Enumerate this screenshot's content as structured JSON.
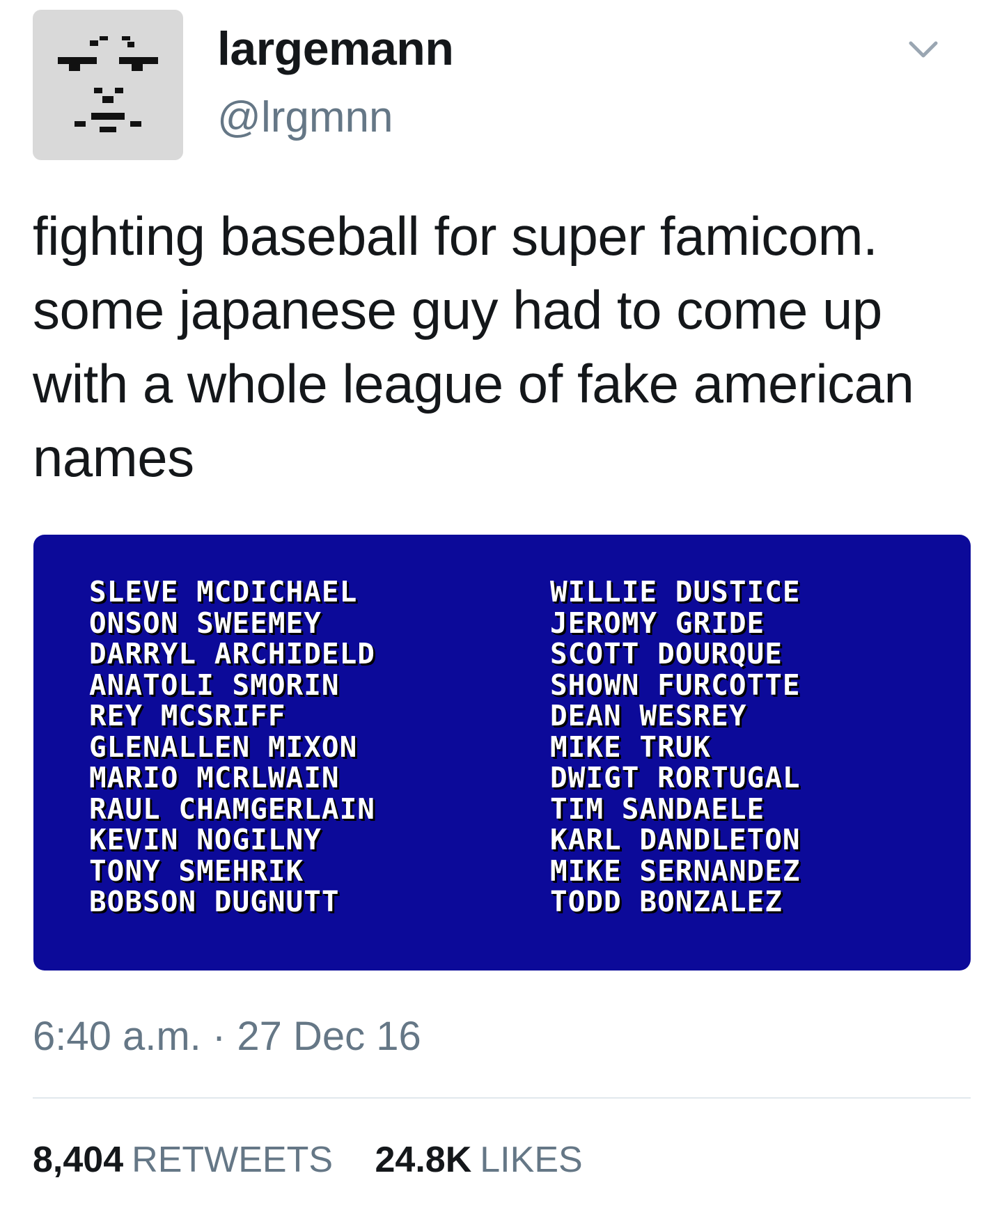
{
  "user": {
    "display_name": "largemann",
    "handle": "@lrgmnn",
    "avatar_icon": "pixel-face-icon"
  },
  "menu": {
    "icon": "chevron-down-icon"
  },
  "tweet": {
    "text": "fighting baseball for super famicom. some japanese guy had to come up with a whole league of fake american names",
    "timestamp": "6:40 a.m. · 27 Dec 16"
  },
  "media": {
    "background_color": "#0c0a99",
    "left_names": [
      "SLEVE MCDICHAEL",
      "ONSON SWEEMEY",
      "DARRYL ARCHIDELD",
      "ANATOLI SMORIN",
      "REY MCSRIFF",
      "GLENALLEN MIXON",
      "MARIO MCRLWAIN",
      "RAUL CHAMGERLAIN",
      "KEVIN NOGILNY",
      "TONY SMEHRIK",
      "BOBSON DUGNUTT"
    ],
    "right_names": [
      "WILLIE DUSTICE",
      "JEROMY GRIDE",
      "SCOTT DOURQUE",
      "SHOWN FURCOTTE",
      "DEAN WESREY",
      "MIKE TRUK",
      "DWIGT RORTUGAL",
      "TIM SANDAELE",
      "KARL DANDLETON",
      "MIKE SERNANDEZ",
      "TODD BONZALEZ"
    ]
  },
  "stats": {
    "retweets_count": "8,404",
    "retweets_label": "RETWEETS",
    "likes_count": "24.8K",
    "likes_label": "LIKES"
  },
  "colors": {
    "text": "#14171a",
    "secondary": "#657786",
    "divider": "#e1e8ed"
  }
}
